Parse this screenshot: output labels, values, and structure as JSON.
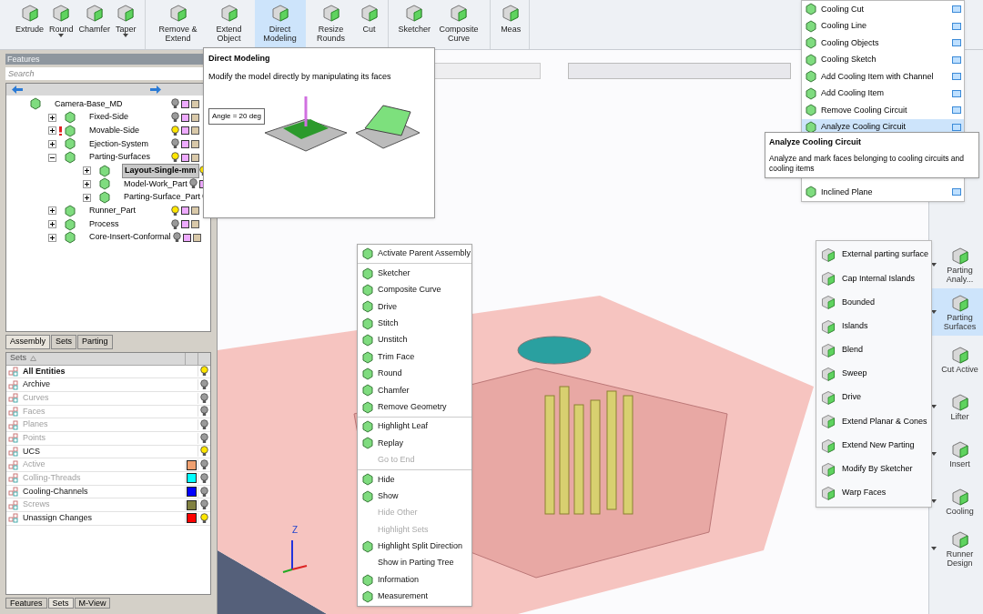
{
  "ribbon": {
    "groups": [
      {
        "buttons": [
          {
            "label": "Extrude",
            "caret": false,
            "selected": false
          },
          {
            "label": "Round",
            "caret": true,
            "selected": false
          },
          {
            "label": "Chamfer",
            "caret": false,
            "selected": false
          },
          {
            "label": "Taper",
            "caret": true,
            "selected": false
          }
        ]
      },
      {
        "buttons": [
          {
            "label": "Remove & Extend",
            "caret": false,
            "selected": false
          },
          {
            "label": "Extend Object",
            "caret": false,
            "selected": false
          },
          {
            "label": "Direct Modeling",
            "caret": false,
            "selected": true
          },
          {
            "label": "Resize Rounds",
            "caret": false,
            "selected": false
          },
          {
            "label": "Cut",
            "caret": false,
            "selected": false
          }
        ]
      },
      {
        "buttons": [
          {
            "label": "Sketcher",
            "caret": false,
            "selected": false
          },
          {
            "label": "Composite Curve",
            "caret": false,
            "selected": false
          }
        ]
      },
      {
        "buttons": [
          {
            "label": "Meas",
            "caret": false,
            "selected": false
          }
        ]
      }
    ]
  },
  "features_panel": {
    "title": "Features",
    "search": {
      "placeholder": "Search"
    },
    "tree": [
      {
        "label": "Camera-Base_MD",
        "selected": false,
        "warning": false,
        "bulb_on": false,
        "children": [
          {
            "label": "Fixed-Side",
            "selected": false,
            "warning": false,
            "bulb_on": false
          },
          {
            "label": "Movable-Side",
            "selected": false,
            "warning": true,
            "bulb_on": true
          },
          {
            "label": "Ejection-System",
            "selected": false,
            "warning": false,
            "bulb_on": false
          },
          {
            "label": "Parting-Surfaces",
            "selected": false,
            "warning": false,
            "bulb_on": true,
            "expanded": true,
            "children": [
              {
                "label": "Layout-Single-mm",
                "selected": true,
                "warning": false,
                "bulb_on": true
              },
              {
                "label": "Model-Work_Part",
                "selected": false,
                "warning": false,
                "bulb_on": false
              },
              {
                "label": "Parting-Surface_Part",
                "selected": false,
                "warning": false,
                "bulb_on": false
              }
            ]
          },
          {
            "label": "Runner_Part",
            "selected": false,
            "warning": false,
            "bulb_on": true
          },
          {
            "label": "Process",
            "selected": false,
            "warning": false,
            "bulb_on": false
          },
          {
            "label": "Core-Insert-Conformal",
            "selected": false,
            "warning": false,
            "bulb_on": false
          }
        ]
      }
    ],
    "tabs": [
      {
        "label": "Assembly",
        "selected": true
      },
      {
        "label": "Sets",
        "selected": false
      },
      {
        "label": "Parting",
        "selected": false
      }
    ]
  },
  "sets_panel": {
    "header": "Sets",
    "rows": [
      {
        "name": "All Entities",
        "bold": true,
        "disabled": false,
        "bulb_on": true
      },
      {
        "name": "Archive",
        "bold": false,
        "disabled": false,
        "bulb_on": false
      },
      {
        "name": "Curves",
        "bold": false,
        "disabled": true,
        "bulb_on": false
      },
      {
        "name": "Faces",
        "bold": false,
        "disabled": true,
        "bulb_on": false
      },
      {
        "name": "Planes",
        "bold": false,
        "disabled": true,
        "bulb_on": false
      },
      {
        "name": "Points",
        "bold": false,
        "disabled": true,
        "bulb_on": false
      },
      {
        "name": "UCS",
        "bold": false,
        "disabled": false,
        "bulb_on": true
      },
      {
        "name": "Active",
        "bold": false,
        "disabled": true,
        "bulb_on": false,
        "color": "#f0a070"
      },
      {
        "name": "Colling-Threads",
        "bold": false,
        "disabled": true,
        "bulb_on": false,
        "color": "#00ffff"
      },
      {
        "name": "Cooling-Channels",
        "bold": false,
        "disabled": false,
        "bulb_on": false,
        "color": "#0000ff"
      },
      {
        "name": "Screws",
        "bold": false,
        "disabled": true,
        "bulb_on": false,
        "color": "#808040"
      },
      {
        "name": "Unassign Changes",
        "bold": false,
        "disabled": false,
        "bulb_on": true,
        "color": "#ff0000"
      }
    ],
    "bottom_tabs": [
      {
        "label": "Features",
        "selected": false
      },
      {
        "label": "Sets",
        "selected": true
      },
      {
        "label": "M-View",
        "selected": false
      }
    ]
  },
  "direct_modeling_tooltip": {
    "title": "Direct Modeling",
    "description": "Modify the model directly by manipulating its faces",
    "angle_field": "Angle = 20 deg"
  },
  "viewport": {
    "axis_label": "Z"
  },
  "context_menu": [
    {
      "kind": "item",
      "label": "Activate Parent Assembly",
      "disabled": false,
      "icon": true
    },
    {
      "kind": "separator"
    },
    {
      "kind": "item",
      "label": "Sketcher",
      "disabled": false,
      "icon": true
    },
    {
      "kind": "item",
      "label": "Composite Curve",
      "disabled": false,
      "icon": true
    },
    {
      "kind": "item",
      "label": "Drive",
      "disabled": false,
      "icon": true
    },
    {
      "kind": "item",
      "label": "Stitch",
      "disabled": false,
      "icon": true
    },
    {
      "kind": "item",
      "label": "Unstitch",
      "disabled": false,
      "icon": true
    },
    {
      "kind": "item",
      "label": "Trim Face",
      "disabled": false,
      "icon": true
    },
    {
      "kind": "item",
      "label": "Round",
      "disabled": false,
      "icon": true
    },
    {
      "kind": "item",
      "label": "Chamfer",
      "disabled": false,
      "icon": true
    },
    {
      "kind": "item",
      "label": "Remove Geometry",
      "disabled": false,
      "icon": true
    },
    {
      "kind": "separator"
    },
    {
      "kind": "item",
      "label": "Highlight Leaf",
      "disabled": false,
      "icon": true
    },
    {
      "kind": "item",
      "label": "Replay",
      "disabled": false,
      "icon": true
    },
    {
      "kind": "item",
      "label": "Go to End",
      "disabled": true,
      "icon": false
    },
    {
      "kind": "separator"
    },
    {
      "kind": "item",
      "label": "Hide",
      "disabled": false,
      "icon": true
    },
    {
      "kind": "item",
      "label": "Show",
      "disabled": false,
      "icon": true
    },
    {
      "kind": "item",
      "label": "Hide Other",
      "disabled": true,
      "icon": false
    },
    {
      "kind": "item",
      "label": "Highlight Sets",
      "disabled": true,
      "icon": false
    },
    {
      "kind": "item",
      "label": "Highlight Split Direction",
      "disabled": false,
      "icon": true
    },
    {
      "kind": "item",
      "label": "Show in Parting Tree",
      "disabled": false,
      "icon": false
    },
    {
      "kind": "item",
      "label": "Information",
      "disabled": false,
      "icon": true
    },
    {
      "kind": "item",
      "label": "Measurement",
      "disabled": false,
      "icon": true
    }
  ],
  "cooling_menu": [
    {
      "label": "Cooling Cut",
      "selected": false
    },
    {
      "label": "Cooling Line",
      "selected": false
    },
    {
      "label": "Cooling Objects",
      "selected": false
    },
    {
      "label": "Cooling Sketch",
      "selected": false
    },
    {
      "label": "Add Cooling Item with Channel",
      "selected": false
    },
    {
      "label": "Add Cooling Item",
      "selected": false
    },
    {
      "label": "Remove Cooling Circuit",
      "selected": false
    },
    {
      "label": "Analyze Cooling Circuit",
      "selected": true
    },
    {
      "label": "Inclined Plane",
      "selected": false
    }
  ],
  "cooling_tooltip": {
    "title": "Analyze Cooling Circuit",
    "description": "Analyze and mark faces belonging to cooling circuits and cooling items"
  },
  "right_toolbar": [
    {
      "label": "Parting Analy...",
      "caret": true,
      "selected": false
    },
    {
      "label": "Parting Surfaces",
      "caret": true,
      "selected": true
    },
    {
      "label": "Cut Active",
      "caret": false,
      "selected": false
    },
    {
      "label": "Lifter",
      "caret": true,
      "selected": false
    },
    {
      "label": "Insert",
      "caret": true,
      "selected": false
    },
    {
      "label": "Cooling",
      "caret": true,
      "selected": false
    },
    {
      "label": "Runner Design",
      "caret": true,
      "selected": false
    }
  ],
  "parting_menu": [
    "External parting surface",
    "Cap Internal Islands",
    "Bounded",
    "Islands",
    "Blend",
    "Sweep",
    "Drive",
    "Extend Planar & Cones",
    "Extend New Parting",
    "Modify By Sketcher",
    "Warp Faces"
  ]
}
